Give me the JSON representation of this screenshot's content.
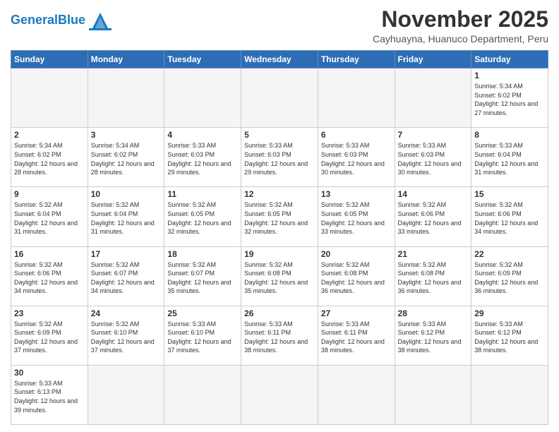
{
  "header": {
    "logo_general": "General",
    "logo_blue": "Blue",
    "month_title": "November 2025",
    "location": "Cayhuayna, Huanuco Department, Peru"
  },
  "weekdays": [
    "Sunday",
    "Monday",
    "Tuesday",
    "Wednesday",
    "Thursday",
    "Friday",
    "Saturday"
  ],
  "days": {
    "1": {
      "sunrise": "5:34 AM",
      "sunset": "6:02 PM",
      "daylight": "12 hours and 27 minutes."
    },
    "2": {
      "sunrise": "5:34 AM",
      "sunset": "6:02 PM",
      "daylight": "12 hours and 28 minutes."
    },
    "3": {
      "sunrise": "5:34 AM",
      "sunset": "6:02 PM",
      "daylight": "12 hours and 28 minutes."
    },
    "4": {
      "sunrise": "5:33 AM",
      "sunset": "6:03 PM",
      "daylight": "12 hours and 29 minutes."
    },
    "5": {
      "sunrise": "5:33 AM",
      "sunset": "6:03 PM",
      "daylight": "12 hours and 29 minutes."
    },
    "6": {
      "sunrise": "5:33 AM",
      "sunset": "6:03 PM",
      "daylight": "12 hours and 30 minutes."
    },
    "7": {
      "sunrise": "5:33 AM",
      "sunset": "6:03 PM",
      "daylight": "12 hours and 30 minutes."
    },
    "8": {
      "sunrise": "5:33 AM",
      "sunset": "6:04 PM",
      "daylight": "12 hours and 31 minutes."
    },
    "9": {
      "sunrise": "5:32 AM",
      "sunset": "6:04 PM",
      "daylight": "12 hours and 31 minutes."
    },
    "10": {
      "sunrise": "5:32 AM",
      "sunset": "6:04 PM",
      "daylight": "12 hours and 31 minutes."
    },
    "11": {
      "sunrise": "5:32 AM",
      "sunset": "6:05 PM",
      "daylight": "12 hours and 32 minutes."
    },
    "12": {
      "sunrise": "5:32 AM",
      "sunset": "6:05 PM",
      "daylight": "12 hours and 32 minutes."
    },
    "13": {
      "sunrise": "5:32 AM",
      "sunset": "6:05 PM",
      "daylight": "12 hours and 33 minutes."
    },
    "14": {
      "sunrise": "5:32 AM",
      "sunset": "6:06 PM",
      "daylight": "12 hours and 33 minutes."
    },
    "15": {
      "sunrise": "5:32 AM",
      "sunset": "6:06 PM",
      "daylight": "12 hours and 34 minutes."
    },
    "16": {
      "sunrise": "5:32 AM",
      "sunset": "6:06 PM",
      "daylight": "12 hours and 34 minutes."
    },
    "17": {
      "sunrise": "5:32 AM",
      "sunset": "6:07 PM",
      "daylight": "12 hours and 34 minutes."
    },
    "18": {
      "sunrise": "5:32 AM",
      "sunset": "6:07 PM",
      "daylight": "12 hours and 35 minutes."
    },
    "19": {
      "sunrise": "5:32 AM",
      "sunset": "6:08 PM",
      "daylight": "12 hours and 35 minutes."
    },
    "20": {
      "sunrise": "5:32 AM",
      "sunset": "6:08 PM",
      "daylight": "12 hours and 36 minutes."
    },
    "21": {
      "sunrise": "5:32 AM",
      "sunset": "6:08 PM",
      "daylight": "12 hours and 36 minutes."
    },
    "22": {
      "sunrise": "5:32 AM",
      "sunset": "6:09 PM",
      "daylight": "12 hours and 36 minutes."
    },
    "23": {
      "sunrise": "5:32 AM",
      "sunset": "6:09 PM",
      "daylight": "12 hours and 37 minutes."
    },
    "24": {
      "sunrise": "5:32 AM",
      "sunset": "6:10 PM",
      "daylight": "12 hours and 37 minutes."
    },
    "25": {
      "sunrise": "5:33 AM",
      "sunset": "6:10 PM",
      "daylight": "12 hours and 37 minutes."
    },
    "26": {
      "sunrise": "5:33 AM",
      "sunset": "6:11 PM",
      "daylight": "12 hours and 38 minutes."
    },
    "27": {
      "sunrise": "5:33 AM",
      "sunset": "6:11 PM",
      "daylight": "12 hours and 38 minutes."
    },
    "28": {
      "sunrise": "5:33 AM",
      "sunset": "6:12 PM",
      "daylight": "12 hours and 38 minutes."
    },
    "29": {
      "sunrise": "5:33 AM",
      "sunset": "6:12 PM",
      "daylight": "12 hours and 38 minutes."
    },
    "30": {
      "sunrise": "5:33 AM",
      "sunset": "6:13 PM",
      "daylight": "12 hours and 39 minutes."
    }
  },
  "labels": {
    "sunrise": "Sunrise:",
    "sunset": "Sunset:",
    "daylight": "Daylight:"
  }
}
